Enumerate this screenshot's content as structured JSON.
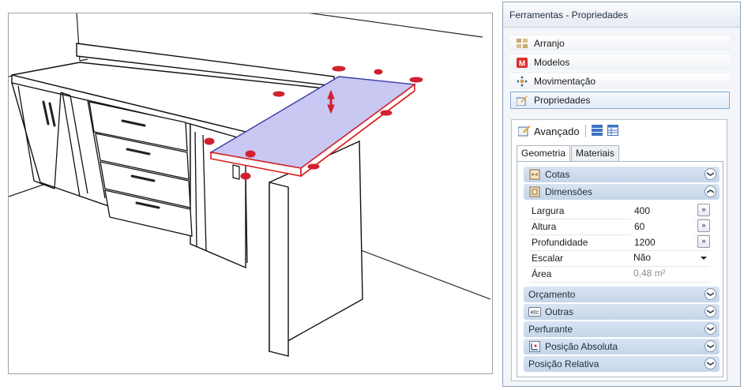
{
  "panel": {
    "title": "Ferramentas - Propriedades",
    "nav": [
      {
        "label": "Arranjo",
        "icon": "arrange-icon"
      },
      {
        "label": "Modelos",
        "icon": "models-icon"
      },
      {
        "label": "Movimentação",
        "icon": "move-icon"
      },
      {
        "label": "Propriedades",
        "icon": "properties-icon",
        "active": true
      }
    ],
    "advanced": {
      "label": "Avançado",
      "icon": "advanced-icon"
    },
    "tabs": [
      {
        "label": "Geometria",
        "active": true
      },
      {
        "label": "Materiais"
      }
    ],
    "sections": {
      "cotas": "Cotas",
      "dimensoes": "Dimensões",
      "orcamento": "Orçamento",
      "outras": "Outras",
      "outras_icon_text": "etc",
      "perfurante": "Perfurante",
      "posicao_absoluta": "Posição Absoluta",
      "posicao_relativa": "Posição Relativa"
    },
    "dimensions": {
      "largura": {
        "label": "Largura",
        "value": "400"
      },
      "altura": {
        "label": "Altura",
        "value": "60"
      },
      "profundidade": {
        "label": "Profundidade",
        "value": "1200"
      },
      "escalar": {
        "label": "Escalar",
        "value": "Não"
      },
      "area": {
        "label": "Área",
        "value": "0,48 m²"
      }
    },
    "expand_symbol": "»"
  },
  "colors": {
    "selection_fill": "#c8c8f2",
    "selection_edge": "#d62020",
    "handle": "#d1202f",
    "section_header": "#c9d8ec"
  }
}
